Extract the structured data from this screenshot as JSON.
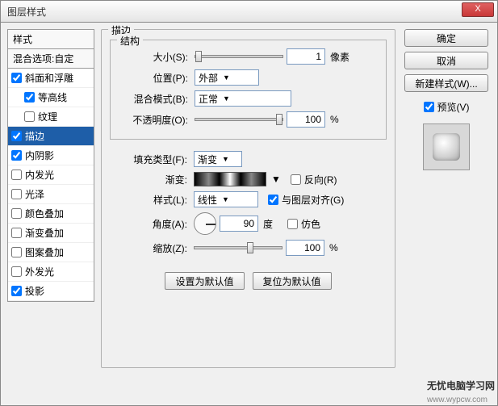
{
  "window": {
    "title": "图层样式",
    "close": "X"
  },
  "sidebar": {
    "header": "样式",
    "blend": "混合选项:自定",
    "items": [
      {
        "label": "斜面和浮雕",
        "checked": true,
        "indent": false
      },
      {
        "label": "等高线",
        "checked": true,
        "indent": true
      },
      {
        "label": "纹理",
        "checked": false,
        "indent": true
      },
      {
        "label": "描边",
        "checked": true,
        "indent": false,
        "selected": true
      },
      {
        "label": "内阴影",
        "checked": true,
        "indent": false
      },
      {
        "label": "内发光",
        "checked": false,
        "indent": false
      },
      {
        "label": "光泽",
        "checked": false,
        "indent": false
      },
      {
        "label": "颜色叠加",
        "checked": false,
        "indent": false
      },
      {
        "label": "渐变叠加",
        "checked": false,
        "indent": false
      },
      {
        "label": "图案叠加",
        "checked": false,
        "indent": false
      },
      {
        "label": "外发光",
        "checked": false,
        "indent": false
      },
      {
        "label": "投影",
        "checked": true,
        "indent": false
      }
    ]
  },
  "stroke": {
    "title": "描边",
    "structure": {
      "title": "结构",
      "size_label": "大小(S):",
      "size_value": "1",
      "size_unit": "像素",
      "position_label": "位置(P):",
      "position_value": "外部",
      "blend_label": "混合模式(B):",
      "blend_value": "正常",
      "opacity_label": "不透明度(O):",
      "opacity_value": "100",
      "opacity_unit": "%"
    },
    "fill": {
      "filltype_label": "填充类型(F):",
      "filltype_value": "渐变",
      "gradient_label": "渐变:",
      "reverse_label": "反向(R)",
      "reverse_checked": false,
      "style_label": "样式(L):",
      "style_value": "线性",
      "align_label": "与图层对齐(G)",
      "align_checked": true,
      "angle_label": "角度(A):",
      "angle_value": "90",
      "angle_unit": "度",
      "dither_label": "仿色",
      "dither_checked": false,
      "scale_label": "缩放(Z):",
      "scale_value": "100",
      "scale_unit": "%"
    },
    "defaults": {
      "set": "设置为默认值",
      "reset": "复位为默认值"
    }
  },
  "rightbar": {
    "ok": "确定",
    "cancel": "取消",
    "newstyle": "新建样式(W)...",
    "preview_label": "预览(V)",
    "preview_checked": true
  },
  "watermark": {
    "main": "无忧电脑学习网",
    "sub": "www.wypcw.com"
  }
}
